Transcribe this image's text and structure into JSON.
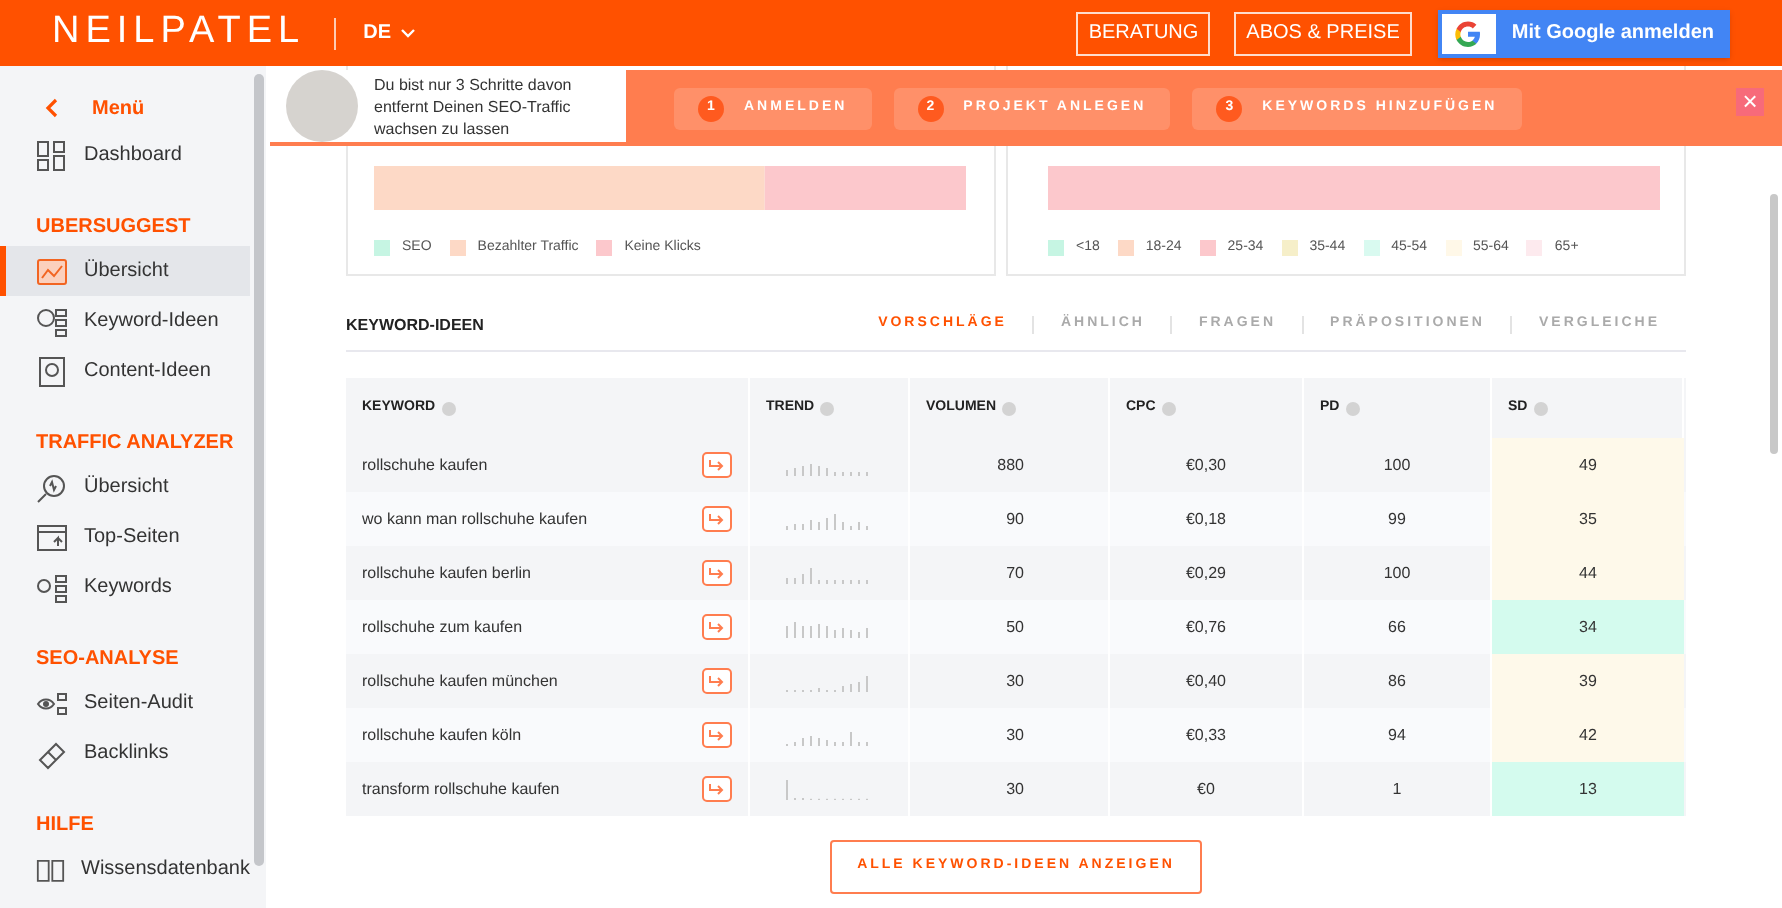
{
  "header": {
    "logo": "NEILPATEL",
    "language": "DE",
    "buttons": [
      "BERATUNG",
      "ABOS & PREISE"
    ],
    "google_button": "Mit Google anmelden"
  },
  "sidebar": {
    "back_label": "Menü",
    "top_items": [
      {
        "label": "Dashboard",
        "selected": false
      }
    ],
    "groups": [
      {
        "title": "UBERSUGGEST",
        "items": [
          {
            "label": "Übersicht",
            "selected": true
          },
          {
            "label": "Keyword-Ideen",
            "selected": false
          },
          {
            "label": "Content-Ideen",
            "selected": false
          }
        ]
      },
      {
        "title": "TRAFFIC ANALYZER",
        "items": [
          {
            "label": "Übersicht",
            "selected": false
          },
          {
            "label": "Top-Seiten",
            "selected": false
          },
          {
            "label": "Keywords",
            "selected": false
          }
        ]
      },
      {
        "title": "SEO-ANALYSE",
        "items": [
          {
            "label": "Seiten-Audit",
            "selected": false
          },
          {
            "label": "Backlinks",
            "selected": false
          }
        ]
      },
      {
        "title": "HILFE",
        "items": [
          {
            "label": "Wissensdatenbank",
            "selected": false
          }
        ]
      }
    ]
  },
  "banner": {
    "message": "Du bist nur 3 Schritte davon entfernt Deinen SEO-Traffic wachsen zu lassen",
    "steps": [
      {
        "number": "1",
        "label": "ANMELDEN"
      },
      {
        "number": "2",
        "label": "PROJEKT ANLEGEN"
      },
      {
        "number": "3",
        "label": "KEYWORDS HINZUFÜGEN"
      }
    ],
    "close": "×"
  },
  "cards": [
    {
      "legend": [
        {
          "label": "SEO",
          "color": "#c6f5e3"
        },
        {
          "label": "Bezahlter Traffic",
          "color": "#fdd9c6"
        },
        {
          "label": "Keine Klicks",
          "color": "#fcc8cc"
        }
      ]
    },
    {
      "legend": [
        {
          "label": "<18",
          "color": "#c6f5e3"
        },
        {
          "label": "18-24",
          "color": "#fdd9c6"
        },
        {
          "label": "25-34",
          "color": "#fcc8cc"
        },
        {
          "label": "35-44",
          "color": "#f6efc9"
        },
        {
          "label": "45-54",
          "color": "#d9faf0"
        },
        {
          "label": "55-64",
          "color": "#fff8e8"
        },
        {
          "label": "65+",
          "color": "#fdeaee"
        }
      ]
    }
  ],
  "keyword_ideas": {
    "title": "KEYWORD-IDEEN",
    "tabs": [
      {
        "label": "VORSCHLÄGE",
        "selected": true
      },
      {
        "label": "ÄHNLICH",
        "selected": false
      },
      {
        "label": "FRAGEN",
        "selected": false
      },
      {
        "label": "PRÄPOSITIONEN",
        "selected": false
      },
      {
        "label": "VERGLEICHE",
        "selected": false
      }
    ],
    "columns": [
      "KEYWORD",
      "TREND",
      "VOLUMEN",
      "CPC",
      "PD",
      "SD"
    ],
    "rows": [
      {
        "keyword": "rollschuhe kaufen",
        "volume": "880",
        "cpc": "€0,30",
        "pd": "100",
        "sd": "49",
        "color": "#fef9ea"
      },
      {
        "keyword": "wo kann man rollschuhe kaufen",
        "volume": "90",
        "cpc": "€0,18",
        "pd": "99",
        "sd": "35",
        "color": "#fef9ea"
      },
      {
        "keyword": "rollschuhe kaufen berlin",
        "volume": "70",
        "cpc": "€0,29",
        "pd": "100",
        "sd": "44",
        "color": "#fef9ea"
      },
      {
        "keyword": "rollschuhe zum kaufen",
        "volume": "50",
        "cpc": "€0,76",
        "pd": "66",
        "sd": "34",
        "color": "#d4fbee"
      },
      {
        "keyword": "rollschuhe kaufen münchen",
        "volume": "30",
        "cpc": "€0,40",
        "pd": "86",
        "sd": "39",
        "color": "#fef9ea"
      },
      {
        "keyword": "rollschuhe kaufen köln",
        "volume": "30",
        "cpc": "€0,33",
        "pd": "94",
        "sd": "42",
        "color": "#fef9ea"
      },
      {
        "keyword": "transform rollschuhe kaufen",
        "volume": "30",
        "cpc": "€0",
        "pd": "1",
        "sd": "13",
        "color": "#d4fbee"
      }
    ],
    "show_all_button": "ALLE KEYWORD-IDEEN ANZEIGEN"
  }
}
